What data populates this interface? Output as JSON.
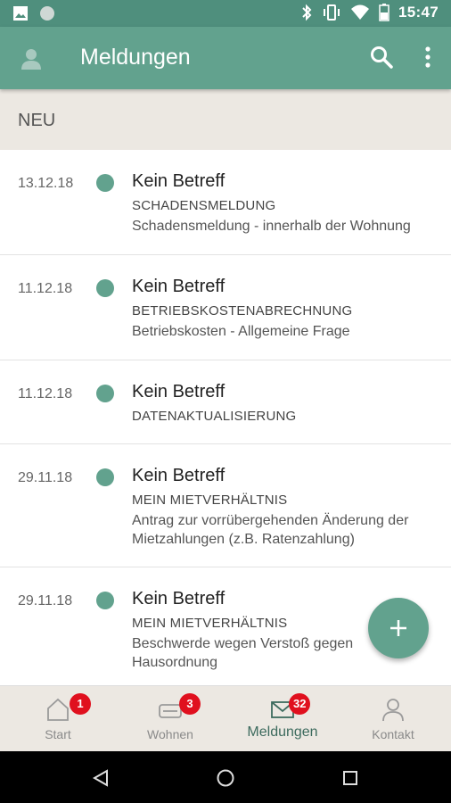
{
  "status_bar": {
    "time": "15:47",
    "icons": [
      "image-icon",
      "circle-notification-icon",
      "bluetooth-icon",
      "vibrate-icon",
      "wifi-icon",
      "battery-icon"
    ]
  },
  "app_bar": {
    "title": "Meldungen",
    "icons": [
      "profile-icon",
      "search-icon",
      "more-vert-icon"
    ]
  },
  "section_header": "NEU",
  "messages": [
    {
      "date": "13.12.18",
      "subject": "Kein Betreff",
      "category": "SCHADENSMELDUNG",
      "description": "Schadensmeldung - innerhalb der Wohnung"
    },
    {
      "date": "11.12.18",
      "subject": "Kein Betreff",
      "category": "BETRIEBSKOSTENABRECHNUNG",
      "description": "Betriebskosten - Allgemeine Frage"
    },
    {
      "date": "11.12.18",
      "subject": "Kein Betreff",
      "category": "DATENAKTUALISIERUNG",
      "description": ""
    },
    {
      "date": "29.11.18",
      "subject": "Kein Betreff",
      "category": "MEIN MIETVERHÄLTNIS",
      "description": "Antrag zur vorrübergehenden Änderung der Mietzahlungen (z.B. Ratenzahlung)"
    },
    {
      "date": "29.11.18",
      "subject": "Kein Betreff",
      "category": "MEIN MIETVERHÄLTNIS",
      "description": "Beschwerde wegen Verstoß gegen Hausordnung"
    }
  ],
  "fab": {
    "icon": "plus-icon"
  },
  "bottom_nav": [
    {
      "label": "Start",
      "badge": "1",
      "icon": "home-icon"
    },
    {
      "label": "Wohnen",
      "badge": "3",
      "icon": "sofa-icon"
    },
    {
      "label": "Meldungen",
      "badge": "32",
      "icon": "mail-icon",
      "active": true
    },
    {
      "label": "Kontakt",
      "badge": "",
      "icon": "person-icon"
    }
  ],
  "system_nav": [
    "back-icon",
    "home-circle-icon",
    "recents-icon"
  ],
  "colors": {
    "primary": "#62a28e",
    "primary_dark": "#4f8f7d",
    "section_bg": "#ece8e2",
    "badge": "#e0101e",
    "active_nav": "#3d6b5e"
  }
}
